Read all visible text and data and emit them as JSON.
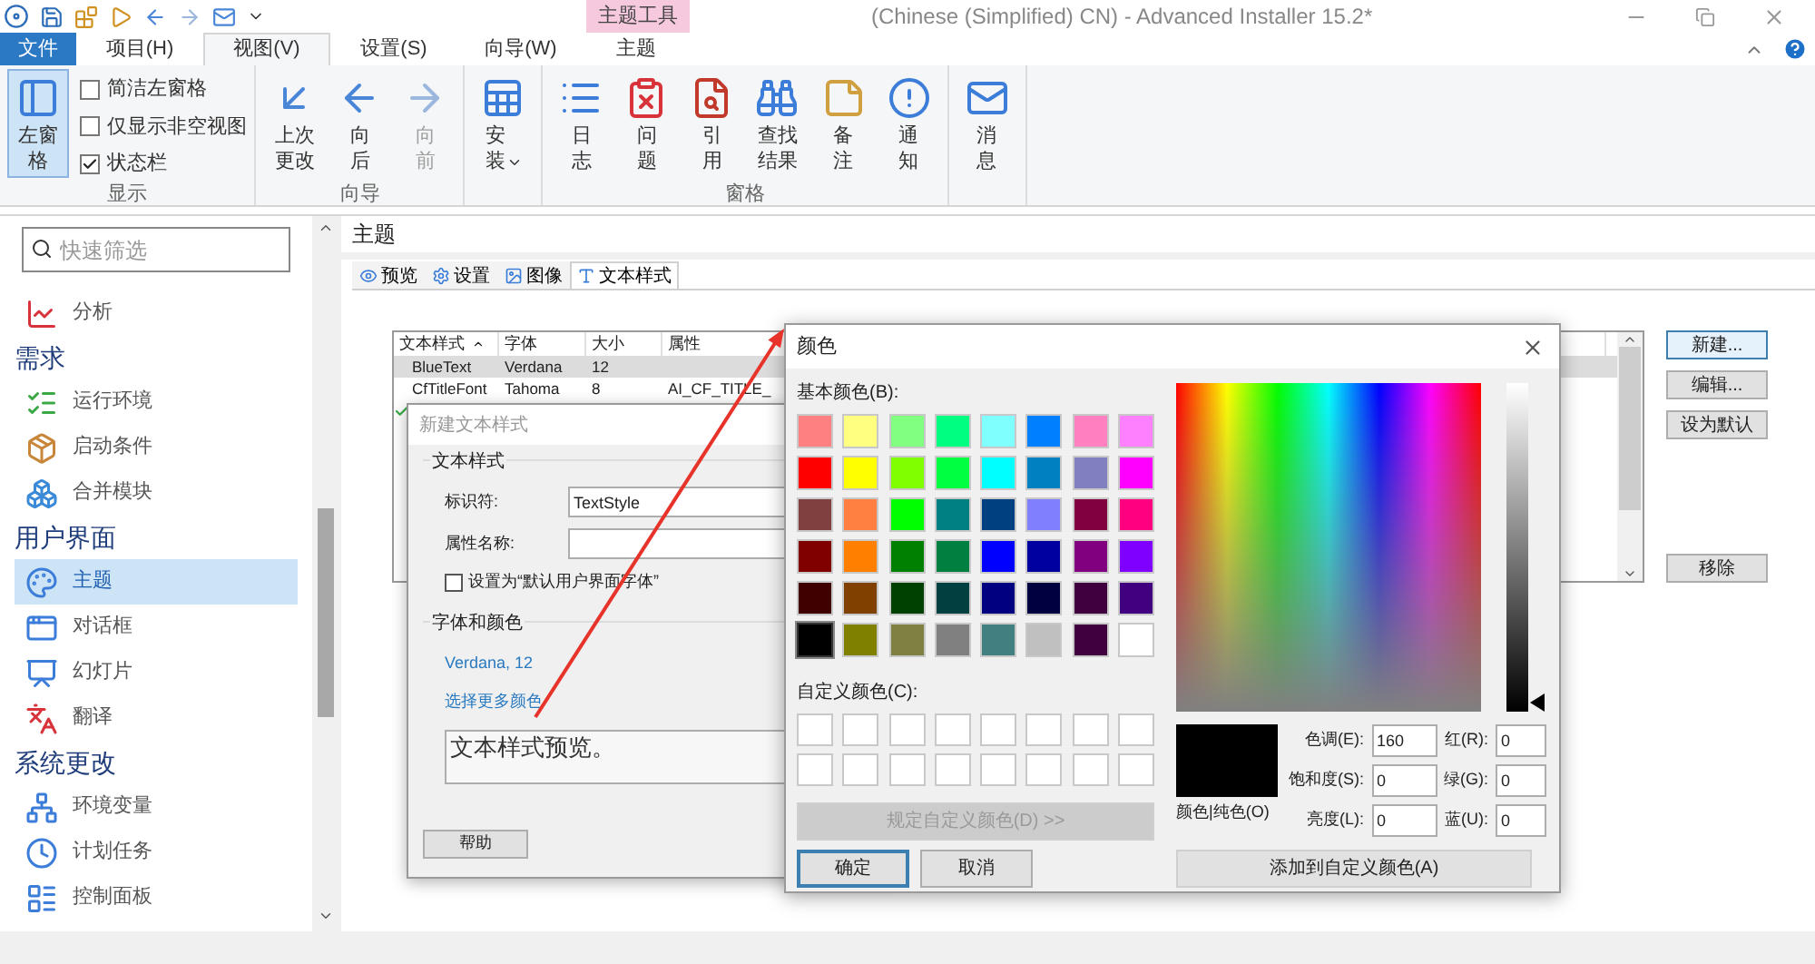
{
  "title_bar": {
    "context_tab_group": "主题工具",
    "title": "(Chinese (Simplified) CN) - Advanced Installer 15.2*"
  },
  "ribbon_tabs": [
    {
      "label": "文件",
      "kind": "file",
      "selected": false
    },
    {
      "label": "项目(H)",
      "kind": "tab",
      "selected": false
    },
    {
      "label": "视图(V)",
      "kind": "tab",
      "selected": true
    },
    {
      "label": "设置(S)",
      "kind": "tab",
      "selected": false
    },
    {
      "label": "向导(W)",
      "kind": "tab",
      "selected": false
    },
    {
      "label": "主题",
      "kind": "context",
      "selected": false
    }
  ],
  "ribbon_groups": [
    {
      "label": "显示",
      "buttons": [
        {
          "label": "左窗格",
          "selected": true,
          "disabled": false
        }
      ],
      "checkboxes": [
        {
          "label": "简洁左窗格",
          "checked": false
        },
        {
          "label": "仅显示非空视图",
          "checked": false
        },
        {
          "label": "状态栏",
          "checked": true
        }
      ]
    },
    {
      "label": "向导",
      "buttons": [
        {
          "label": "上次更改",
          "selected": false,
          "disabled": false
        },
        {
          "label": "向后",
          "selected": false,
          "disabled": false
        },
        {
          "label": "向前",
          "selected": false,
          "disabled": true
        }
      ]
    },
    {
      "buttons": [
        {
          "label": "安装",
          "selected": false,
          "disabled": false,
          "dropdown": true
        }
      ]
    },
    {
      "label": "窗格",
      "buttons": [
        {
          "label": "日志",
          "selected": false,
          "disabled": false
        },
        {
          "label": "问题",
          "selected": false,
          "disabled": false
        },
        {
          "label": "引用",
          "selected": false,
          "disabled": false
        },
        {
          "label": "查找结果",
          "selected": false,
          "disabled": false
        },
        {
          "label": "备注",
          "selected": false,
          "disabled": false
        },
        {
          "label": "通知",
          "selected": false,
          "disabled": false
        }
      ]
    },
    {
      "buttons": [
        {
          "label": "消息",
          "selected": false,
          "disabled": false
        }
      ]
    }
  ],
  "sidebar": {
    "search": {
      "placeholder": "快速筛选"
    },
    "items": [
      {
        "kind": "item",
        "label": "分析",
        "selected": false
      },
      {
        "kind": "section",
        "label": "需求"
      },
      {
        "kind": "item",
        "label": "运行环境",
        "selected": false
      },
      {
        "kind": "item",
        "label": "启动条件",
        "selected": false
      },
      {
        "kind": "item",
        "label": "合并模块",
        "selected": false
      },
      {
        "kind": "section",
        "label": "用户界面"
      },
      {
        "kind": "item",
        "label": "主题",
        "selected": true
      },
      {
        "kind": "item",
        "label": "对话框",
        "selected": false
      },
      {
        "kind": "item",
        "label": "幻灯片",
        "selected": false
      },
      {
        "kind": "item",
        "label": "翻译",
        "selected": false
      },
      {
        "kind": "section",
        "label": "系统更改"
      },
      {
        "kind": "item",
        "label": "环境变量",
        "selected": false
      },
      {
        "kind": "item",
        "label": "计划任务",
        "selected": false
      },
      {
        "kind": "item",
        "label": "控制面板",
        "selected": false
      }
    ]
  },
  "main": {
    "title": "主题",
    "tabs": [
      {
        "label": "预览",
        "selected": false
      },
      {
        "label": "设置",
        "selected": false
      },
      {
        "label": "图像",
        "selected": false
      },
      {
        "label": "文本样式",
        "selected": true
      }
    ],
    "table": {
      "columns": [
        {
          "label": "文本样式",
          "sorted": true
        },
        {
          "label": "字体",
          "sorted": false
        },
        {
          "label": "大小",
          "sorted": false
        },
        {
          "label": "属性",
          "sorted": false
        }
      ],
      "rows": [
        {
          "cells": [
            "BlueText",
            "Verdana",
            "12"
          ],
          "selected": true,
          "checked": false
        },
        {
          "cells": [
            "CfTitleFont",
            "Tahoma",
            "8",
            "AI_CF_TITLE_"
          ],
          "selected": false,
          "checked": false
        },
        {
          "selected": false,
          "checked": true
        }
      ]
    },
    "buttons": [
      {
        "label": "新建...",
        "focused": true
      },
      {
        "label": "编辑...",
        "focused": false
      },
      {
        "label": "设为默认",
        "focused": false
      },
      {
        "label": "移除",
        "focused": false
      }
    ]
  },
  "new_style_dialog": {
    "title": "新建文本样式",
    "section_text_style": "文本样式",
    "identifier": {
      "label": "标识符:",
      "value": "TextStyle"
    },
    "property_name": {
      "label": "属性名称:"
    },
    "default_font_checkbox": {
      "label": "设置为“默认用户界面字体”",
      "checked": false
    },
    "section_font_color": "字体和颜色",
    "font_link": "Verdana, 12",
    "color_link": "选择更多颜色",
    "preview_text": "文本样式预览。",
    "help_button": "帮助"
  },
  "color_dialog": {
    "title": "颜色",
    "basic_label": "基本颜色(B):",
    "basic_colors": [
      {
        "color": "#ff8080",
        "selected": false
      },
      {
        "color": "#ffff80",
        "selected": false
      },
      {
        "color": "#80ff80",
        "selected": false
      },
      {
        "color": "#00ff80",
        "selected": false
      },
      {
        "color": "#80ffff",
        "selected": false
      },
      {
        "color": "#0080ff",
        "selected": false
      },
      {
        "color": "#ff80c0",
        "selected": false
      },
      {
        "color": "#ff80ff",
        "selected": false
      },
      {
        "color": "#ff0000",
        "selected": false
      },
      {
        "color": "#ffff00",
        "selected": false
      },
      {
        "color": "#80ff00",
        "selected": false
      },
      {
        "color": "#00ff40",
        "selected": false
      },
      {
        "color": "#00ffff",
        "selected": false
      },
      {
        "color": "#0080c0",
        "selected": false
      },
      {
        "color": "#8080c0",
        "selected": false
      },
      {
        "color": "#ff00ff",
        "selected": false
      },
      {
        "color": "#804040",
        "selected": false
      },
      {
        "color": "#ff8040",
        "selected": false
      },
      {
        "color": "#00ff00",
        "selected": false
      },
      {
        "color": "#008080",
        "selected": false
      },
      {
        "color": "#004080",
        "selected": false
      },
      {
        "color": "#8080ff",
        "selected": false
      },
      {
        "color": "#800040",
        "selected": false
      },
      {
        "color": "#ff0080",
        "selected": false
      },
      {
        "color": "#800000",
        "selected": false
      },
      {
        "color": "#ff8000",
        "selected": false
      },
      {
        "color": "#008000",
        "selected": false
      },
      {
        "color": "#008040",
        "selected": false
      },
      {
        "color": "#0000ff",
        "selected": false
      },
      {
        "color": "#0000a0",
        "selected": false
      },
      {
        "color": "#800080",
        "selected": false
      },
      {
        "color": "#8000ff",
        "selected": false
      },
      {
        "color": "#400000",
        "selected": false
      },
      {
        "color": "#804000",
        "selected": false
      },
      {
        "color": "#004000",
        "selected": false
      },
      {
        "color": "#004040",
        "selected": false
      },
      {
        "color": "#000080",
        "selected": false
      },
      {
        "color": "#000040",
        "selected": false
      },
      {
        "color": "#400040",
        "selected": false
      },
      {
        "color": "#400080",
        "selected": false
      },
      {
        "color": "#000000",
        "selected": true
      },
      {
        "color": "#808000",
        "selected": false
      },
      {
        "color": "#808040",
        "selected": false
      },
      {
        "color": "#808080",
        "selected": false
      },
      {
        "color": "#408080",
        "selected": false
      },
      {
        "color": "#c0c0c0",
        "selected": false
      },
      {
        "color": "#400040",
        "selected": false
      },
      {
        "color": "#ffffff",
        "selected": false
      }
    ],
    "custom_label": "自定义颜色(C):",
    "luminance": {
      "level": 0
    },
    "define_button": {
      "label": "规定自定义颜色(D) >>",
      "disabled": true
    },
    "ok_button": "确定",
    "cancel_button": "取消",
    "solid_label": "颜色|纯色(O)",
    "fields": [
      {
        "label": "色调(E):",
        "value": "160"
      },
      {
        "label": "红(R):",
        "value": "0"
      },
      {
        "label": "饱和度(S):",
        "value": "0"
      },
      {
        "label": "绿(G):",
        "value": "0"
      },
      {
        "label": "亮度(L):",
        "value": "0"
      },
      {
        "label": "蓝(U):",
        "value": "0"
      }
    ],
    "add_button": "添加到自定义颜色(A)"
  }
}
